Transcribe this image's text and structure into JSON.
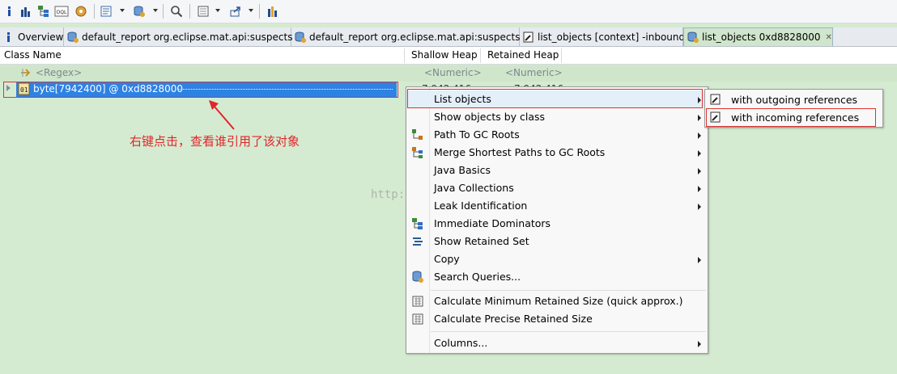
{
  "toolbar": {
    "icons": [
      "info-icon",
      "histogram-icon",
      "dominator-tree-icon",
      "oql-icon",
      "heap-dump-overview-icon",
      "query-browser-icon",
      "query-history-icon",
      "search-icon",
      "calculate-icon",
      "export-icon",
      "group-by-icon"
    ]
  },
  "tabs": [
    {
      "label": "Overview"
    },
    {
      "label": "default_report  org.eclipse.mat.api:suspects"
    },
    {
      "label": "default_report  org.eclipse.mat.api:suspects"
    },
    {
      "label": "list_objects [context] -inbound"
    },
    {
      "label": "list_objects 0xd8828000"
    }
  ],
  "table": {
    "columns": [
      "Class Name",
      "Shallow Heap",
      "Retained Heap"
    ],
    "filter": {
      "regex": "<Regex>",
      "numeric1": "<Numeric>",
      "numeric2": "<Numeric>"
    },
    "row": {
      "name": "byte[7942400] @ 0xd8828000",
      "shallow": "7,942,416",
      "retained": "7,942,416"
    }
  },
  "annotation": "右键点击，查看谁引用了该对象",
  "watermark": "http://blog.csdn.net/",
  "menu": {
    "items": [
      {
        "label": "List objects",
        "submenu": true,
        "icon": ""
      },
      {
        "label": "Show objects by class",
        "submenu": true,
        "icon": ""
      },
      {
        "label": "Path To GC Roots",
        "submenu": true,
        "icon": "gc-roots-icon"
      },
      {
        "label": "Merge Shortest Paths to GC Roots",
        "submenu": true,
        "icon": "merge-paths-icon"
      },
      {
        "label": "Java Basics",
        "submenu": true,
        "icon": ""
      },
      {
        "label": "Java Collections",
        "submenu": true,
        "icon": ""
      },
      {
        "label": "Leak Identification",
        "submenu": true,
        "icon": ""
      },
      {
        "label": "Immediate Dominators",
        "submenu": false,
        "icon": "dominators-icon"
      },
      {
        "label": "Show Retained Set",
        "submenu": false,
        "icon": "retained-set-icon"
      },
      {
        "label": "Copy",
        "submenu": true,
        "icon": ""
      },
      {
        "label": "Search Queries...",
        "submenu": false,
        "icon": "search-queries-icon"
      },
      {
        "label": "Calculate Minimum Retained Size (quick approx.)",
        "submenu": false,
        "icon": "calculator-icon"
      },
      {
        "label": "Calculate Precise Retained Size",
        "submenu": false,
        "icon": "calculator-icon"
      },
      {
        "label": "Columns...",
        "submenu": true,
        "icon": ""
      }
    ]
  },
  "submenu": {
    "items": [
      {
        "label": "with outgoing references"
      },
      {
        "label": "with incoming references"
      }
    ]
  },
  "colors": {
    "selection": "#2d82e3",
    "highlight_box": "#e03232",
    "background": "#d5ebd1"
  }
}
